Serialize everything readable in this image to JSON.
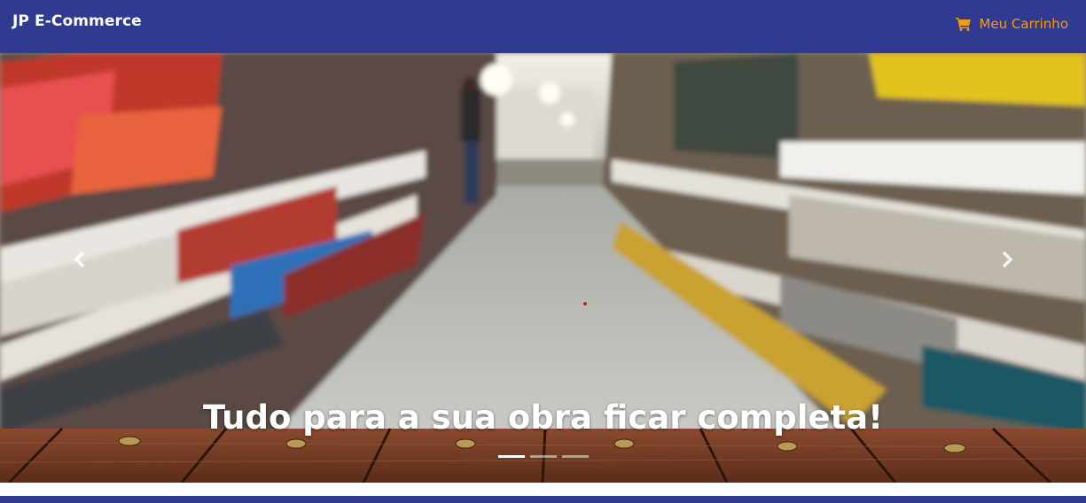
{
  "navbar": {
    "brand": "JP E-Commerce",
    "cart_label": "Meu Carrinho",
    "cart_icon": "shopping-cart-icon",
    "bg_color": "#303a91",
    "cart_color": "#f39c12"
  },
  "carousel": {
    "caption": "Tudo para a sua obra ficar completa!",
    "prev_icon": "chevron-left-icon",
    "next_icon": "chevron-right-icon",
    "active_slide": 1,
    "slide_count": 3
  }
}
